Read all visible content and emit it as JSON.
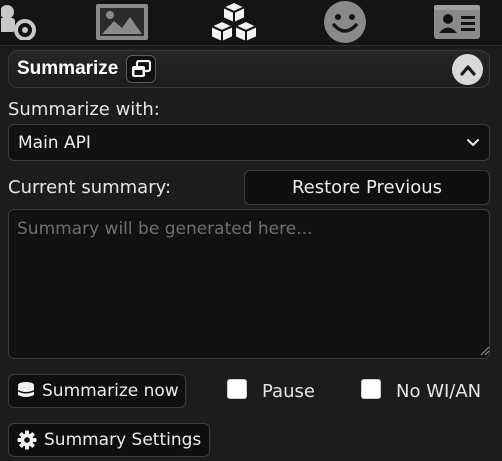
{
  "topbar": {
    "icons": [
      "sliders-icon",
      "image-icon",
      "cubes-icon",
      "smiley-icon",
      "id-card-icon"
    ]
  },
  "drawer": {
    "title": "Summarize",
    "toggle_state": "expanded"
  },
  "summarize_with": {
    "label": "Summarize with:",
    "selected": "Main API"
  },
  "current_summary": {
    "label": "Current summary:",
    "restore_label": "Restore Previous",
    "placeholder": "Summary will be generated here...",
    "value": ""
  },
  "actions": {
    "summarize_now_label": "Summarize now",
    "pause_label": "Pause",
    "pause_checked": false,
    "no_wi_label": "No WI/AN",
    "no_wi_checked": false,
    "settings_label": "Summary Settings"
  },
  "colors": {
    "background": "#1c1c1c",
    "input_bg": "#111111",
    "border": "#3c3c3c",
    "text": "#e6e6e6",
    "placeholder": "#6f6f6f"
  }
}
